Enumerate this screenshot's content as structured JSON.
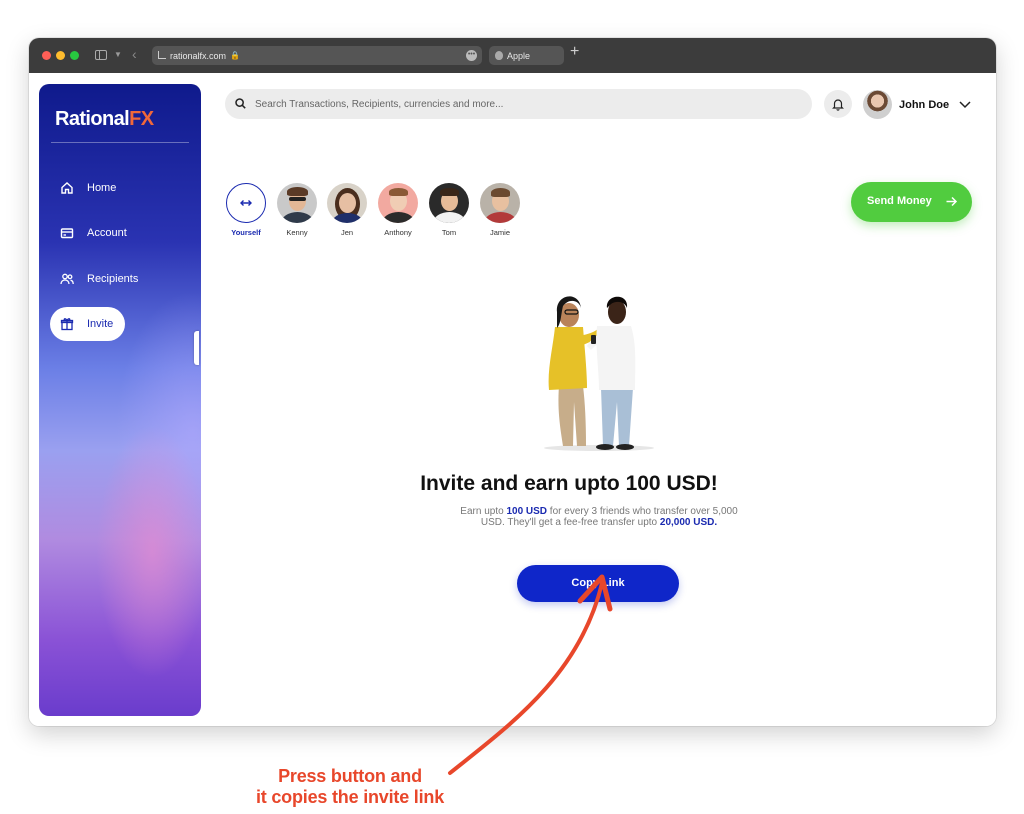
{
  "browser": {
    "url": "rationalfx.com",
    "tab_label": "Apple",
    "new_tab_symbol": "+"
  },
  "app": {
    "logo_main": "Rational",
    "logo_accent": "FX",
    "accent_color": "#f0683a",
    "primary_color": "#0f26c9",
    "success_color": "#51cc3f"
  },
  "sidebar": {
    "items": [
      {
        "label": "Home",
        "icon": "home-icon",
        "active": false
      },
      {
        "label": "Account",
        "icon": "card-icon",
        "active": false
      },
      {
        "label": "Recipients",
        "icon": "users-icon",
        "active": false
      },
      {
        "label": "Invite",
        "icon": "gift-icon",
        "active": true
      }
    ]
  },
  "header": {
    "search_placeholder": "Search Transactions, Recipients, currencies and more...",
    "user_name": "John Doe"
  },
  "recipients": [
    {
      "name": "Yourself",
      "icon": "swap-arrows-icon"
    },
    {
      "name": "Kenny"
    },
    {
      "name": "Jen"
    },
    {
      "name": "Anthony"
    },
    {
      "name": "Tom"
    },
    {
      "name": "Jamie"
    }
  ],
  "send_money": {
    "label": "Send Money",
    "icon": "arrow-right-icon"
  },
  "invite": {
    "title": "Invite and earn upto 100 USD!",
    "desc_part1": "Earn upto ",
    "desc_amount": "100 USD",
    "desc_part2": " for every 3 friends who transfer over 5,000 USD. They'll get a fee-free transfer upto ",
    "desc_limit": "20,000 USD.",
    "button_label": "Copy Link"
  },
  "annotation": {
    "line1": "Press button and",
    "line2": "it copies the invite link",
    "color": "#e8472b"
  }
}
